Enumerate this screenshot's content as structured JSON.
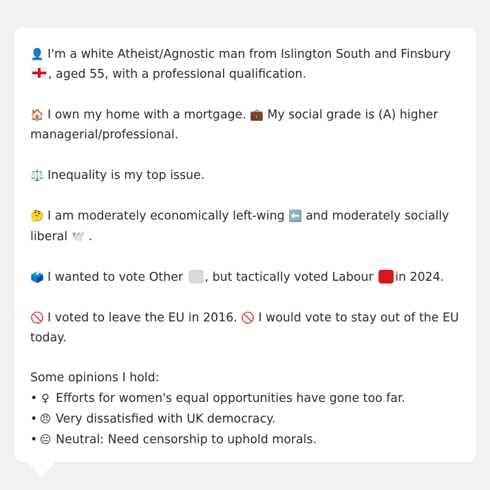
{
  "lines": {
    "p1a": "I'm a white Atheist/Agnostic man from Islington South and Finsbury",
    "p1b": ", aged 55, with a professional qualification.",
    "p2a": "I own my home with a mortgage.",
    "p2b": "My social grade is (A) higher managerial/professional.",
    "p3": "Inequality is my top issue.",
    "p4a": "I am moderately economically left-wing",
    "p4b": "and moderately socially liberal",
    "p4c": ".",
    "p5a": "I wanted to vote Other",
    "p5b": ", but tactically voted Labour",
    "p5c": "in 2024.",
    "p6a": "I voted to leave the EU in 2016.",
    "p6b": "I would vote to stay out of the EU today.",
    "opinions_title": "Some opinions I hold:",
    "opinions": [
      {
        "icon_glyph": "♀",
        "text": "Efforts for women's equal opportunities have gone too far."
      },
      {
        "icon_glyph": "😠",
        "text": "Very dissatisfied with UK democracy."
      },
      {
        "icon_glyph": "😐",
        "text": "Neutral: Need censorship to uphold morals."
      }
    ]
  },
  "icons": {
    "person": "👤",
    "house": "🏠",
    "briefcase": "💼",
    "scales": "⚖️",
    "thinking": "🤔",
    "left_arrow": "⬅️",
    "dove": "🕊️",
    "ballot": "🗳️",
    "no_entry": "🚫"
  },
  "colors": {
    "background": "#f1f2f4",
    "card": "#ffffff",
    "text": "#2a2a2a",
    "labour_red": "#d7191c",
    "other_grey": "#d9dadb",
    "flag_red": "#cf142b"
  }
}
